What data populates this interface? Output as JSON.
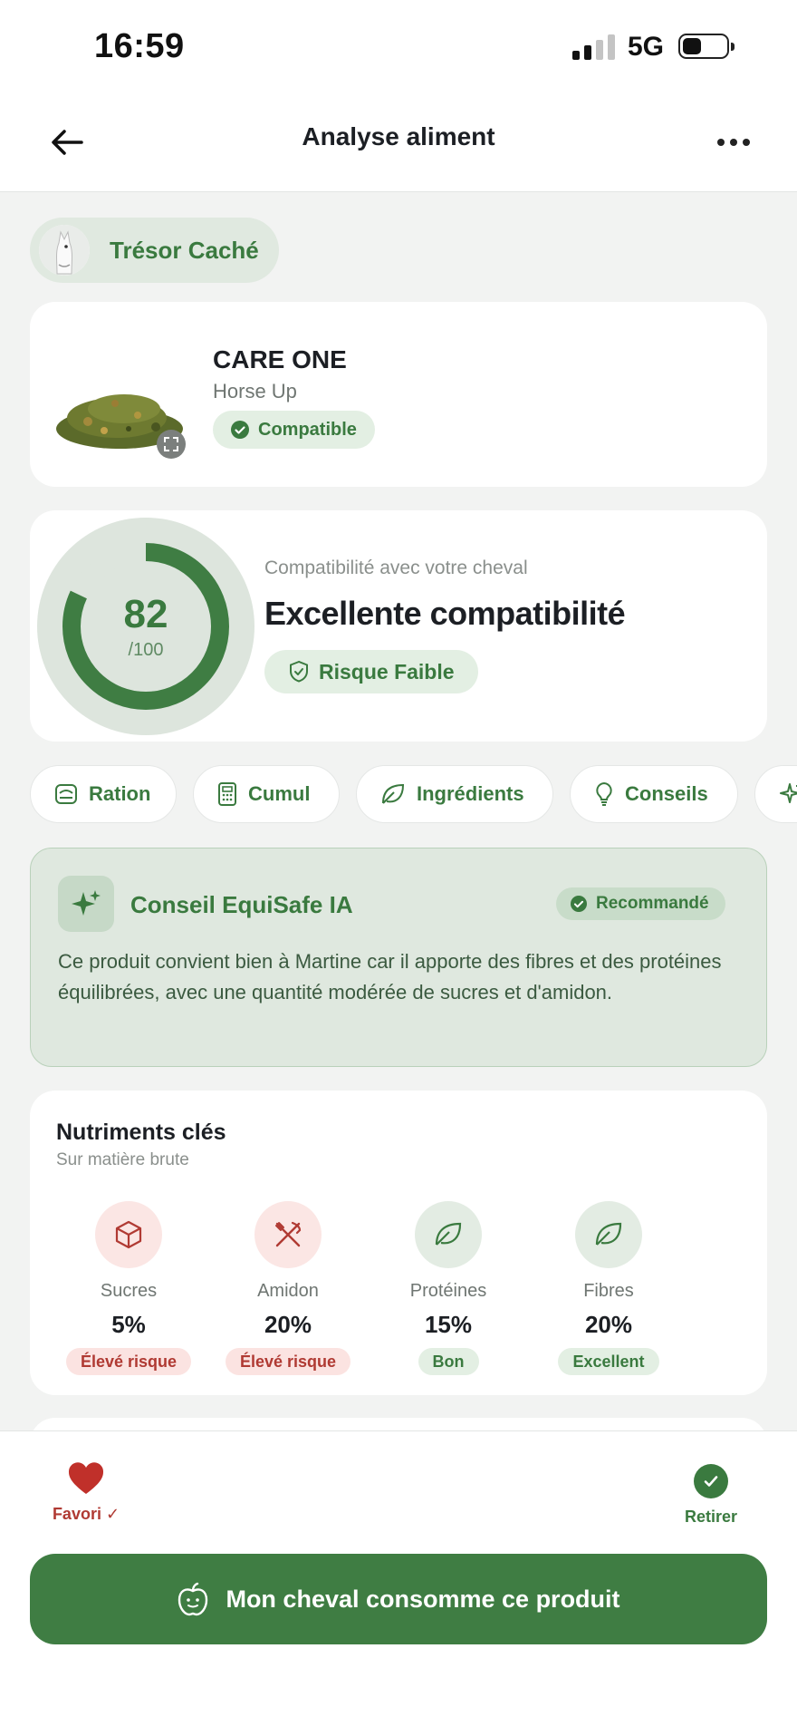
{
  "status": {
    "time": "16:59",
    "network": "5G"
  },
  "header": {
    "title": "Analyse aliment"
  },
  "horse": {
    "name": "Trésor Caché"
  },
  "product": {
    "name": "CARE ONE",
    "brand": "Horse Up",
    "compat_label": "Compatible"
  },
  "score": {
    "value": "82",
    "max": "/100",
    "fraction": 0.82,
    "label": "Compatibilité avec votre cheval",
    "verdict": "Excellente compatibilité",
    "risk": "Risque Faible"
  },
  "tabs": [
    {
      "label": "Ration",
      "icon": "bowl-icon"
    },
    {
      "label": "Cumul",
      "icon": "calculator-icon"
    },
    {
      "label": "Ingrédients",
      "icon": "leaf-icon"
    },
    {
      "label": "Conseils",
      "icon": "lightbulb-icon"
    },
    {
      "label": "",
      "icon": "sparkle-icon"
    }
  ],
  "ai": {
    "title": "Conseil EquiSafe IA",
    "badge": "Recommandé",
    "text": "Ce produit convient bien à Martine car il apporte des fibres et des protéines équilibrées, avec une quantité modérée de sucres et d'amidon."
  },
  "nutrients": {
    "title": "Nutriments clés",
    "subtitle": "Sur matière brute",
    "items": [
      {
        "label": "Sucres",
        "value": "5%",
        "badge": "Élevé risque",
        "icon": "cube-icon"
      },
      {
        "label": "Amidon",
        "value": "20%",
        "badge": "Élevé risque",
        "icon": "utensils-icon"
      },
      {
        "label": "Protéines",
        "value": "15%",
        "badge": "Bon",
        "icon": "leaf-icon"
      },
      {
        "label": "Fibres",
        "value": "20%",
        "badge": "Excellent",
        "icon": "leaf-icon"
      }
    ]
  },
  "bottom": {
    "favorite_label": "Favori ✓",
    "remove_label": "Retirer",
    "cta_label": "Mon cheval consomme ce produit"
  },
  "colors": {
    "brand_green": "#3f7d43",
    "risk_red": "#b03a33"
  }
}
